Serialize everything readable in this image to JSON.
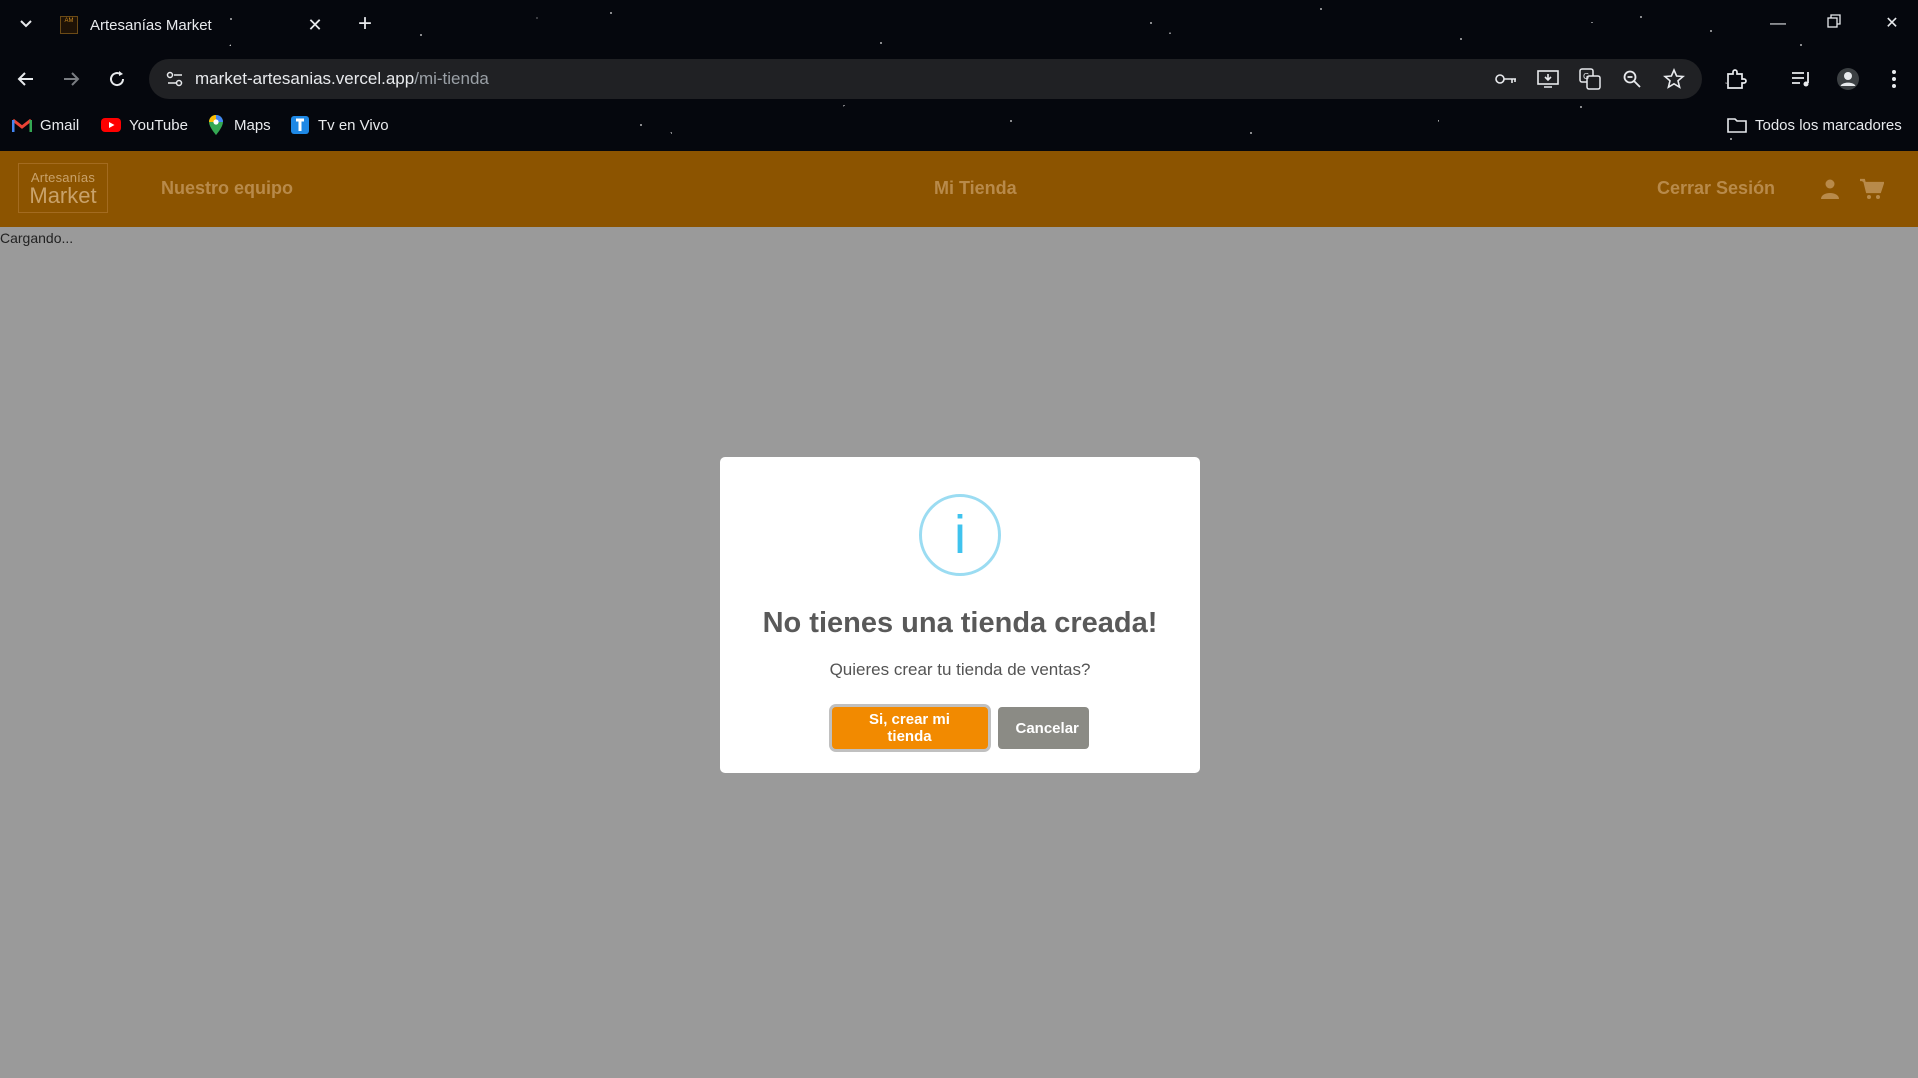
{
  "browser": {
    "tab": {
      "title": "Artesanías Market",
      "favicon_text": "Artesanias Market"
    },
    "url": {
      "domain": "market-artesanias.vercel.app",
      "path": "/mi-tienda"
    },
    "bookmarks": [
      {
        "label": "Gmail",
        "icon": "gmail-icon"
      },
      {
        "label": "YouTube",
        "icon": "youtube-icon"
      },
      {
        "label": "Maps",
        "icon": "maps-icon"
      },
      {
        "label": "Tv en Vivo",
        "icon": "tv-icon"
      }
    ],
    "all_bookmarks_label": "Todos los marcadores"
  },
  "header": {
    "logo_line1": "Artesanías",
    "logo_line2": "Market",
    "nav": {
      "team": "Nuestro equipo",
      "store": "Mi Tienda",
      "logout": "Cerrar Sesión"
    },
    "color": "#8c5400"
  },
  "main": {
    "loading_text": "Cargando..."
  },
  "modal": {
    "icon_glyph": "i",
    "title": "No tienes una tienda creada!",
    "text": "Quieres crear tu tienda de ventas?",
    "confirm_label": "Si, crear mi tienda",
    "cancel_label": "Cancelar",
    "confirm_color": "#f28a00",
    "cancel_color": "#8b8b85"
  }
}
